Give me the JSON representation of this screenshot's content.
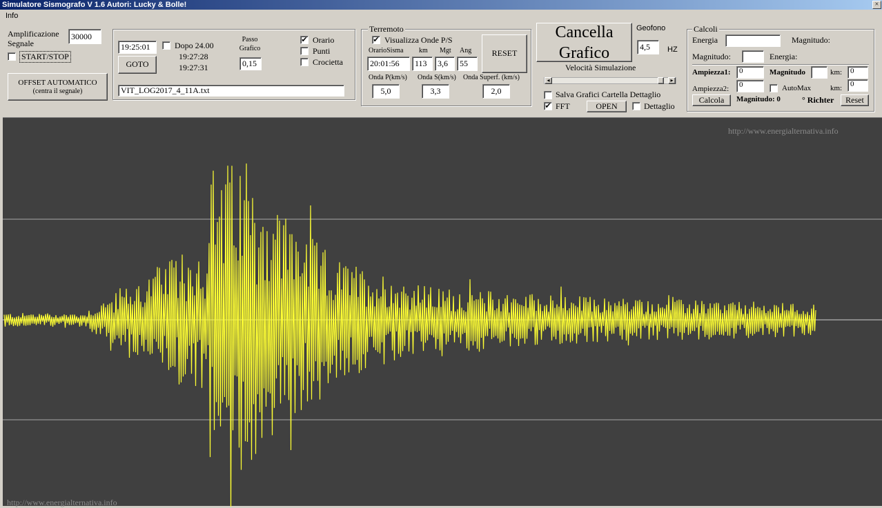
{
  "window": {
    "title": "Simulatore Sismografo V 1.6  Autori: Lucky & Bolle!",
    "close": "×"
  },
  "menu": {
    "info": "Info"
  },
  "signal": {
    "amp_label": "Amplificazione Segnale",
    "amp_value": "30000",
    "start_stop": "START/STOP",
    "offset_line1": "OFFSET AUTOMATICO",
    "offset_line2": "(centra il segnale)"
  },
  "time": {
    "time_value": "19:25:01",
    "dopo": "Dopo 24.00",
    "t1": "19:27:28",
    "t2": "19:27:31",
    "goto": "GOTO",
    "passo_line1": "Passo",
    "passo_line2": "Grafico",
    "passo_value": "0,15",
    "file": "VIT_LOG2017_4_11A.txt"
  },
  "view": {
    "orario": "Orario",
    "orario_checked": "✔",
    "punti": "Punti",
    "crocietta": "Crocietta"
  },
  "terremoto": {
    "legend": "Terremoto",
    "visualizza": "Visualizza Onde P/S",
    "visualizza_checked": "✔",
    "h_orario": "OrarioSisma",
    "h_km": "km",
    "h_mgt": "Mgt",
    "h_ang": "Ang",
    "orario": "20:01:56",
    "km": "113",
    "mgt": "3,6",
    "ang": "55",
    "onda_p_label": "Onda P(km/s)",
    "onda_s_label": "Onda S(km/s)",
    "onda_sup_label": "Onda Superf. (km/s)",
    "onda_p": "5,0",
    "onda_s": "3,3",
    "onda_sup": "2,0",
    "reset": "RESET"
  },
  "grafico": {
    "cancella_line1": "Cancella",
    "cancella_line2": "Grafico",
    "geofono": "Geofono",
    "geofono_value": "4,5",
    "hz": "HZ",
    "velocita": "Velocità Simulazione",
    "slider_left": "◂",
    "slider_right": "▸",
    "slider_level": 0.95,
    "salva": "Salva Grafici Cartella Dettaglio",
    "fft": "FFT",
    "fft_checked": "✔",
    "open": "OPEN",
    "dettaglio": "Dettaglio"
  },
  "calcoli": {
    "legend": "Calcoli",
    "energia": "Energia",
    "magnitudo": "Magnitudo:",
    "magnitudo2": "Magnitudo:",
    "energia2": "Energia:",
    "ampiezza1": "Ampiezza1:",
    "ampiezza1_value": "0",
    "magnitudo_b": "Magnitudo",
    "km1": "km:",
    "km1_value": "0",
    "ampiezza2": "Ampiezza2:",
    "ampiezza2_value": "0",
    "automax": "AutoMax",
    "km2": "km:",
    "km2_value": "0",
    "calcola": "Calcola",
    "magn_result": "Magnitudo: 0",
    "richter": "° Richter",
    "reset": "Reset"
  },
  "plot": {
    "watermark_top": "http://www.energialternativa.info",
    "watermark_bottom": "http://www.energialternativa.info",
    "trace_color": "#ffff33",
    "background": "#404040"
  }
}
